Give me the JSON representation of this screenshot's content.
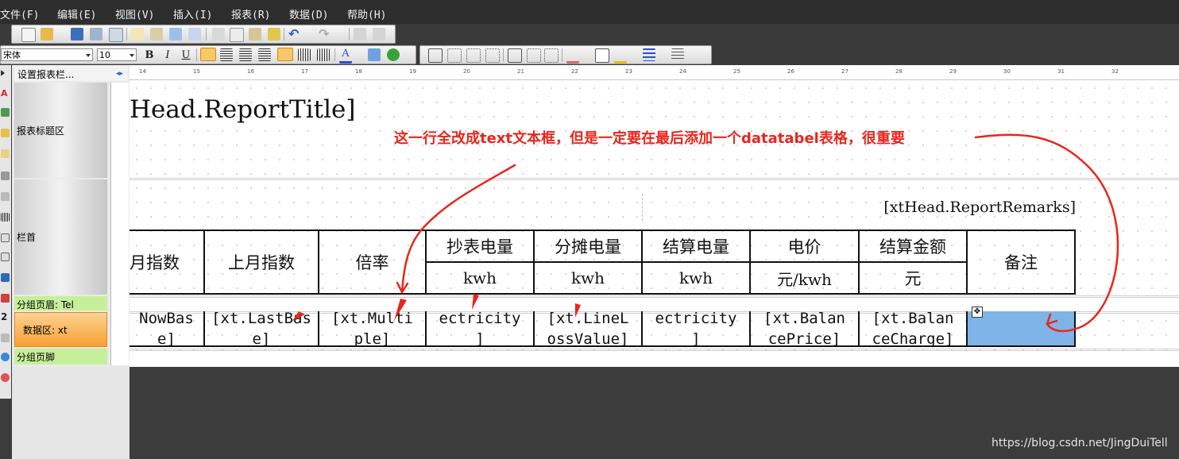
{
  "menu": [
    "文件(F)",
    "编辑(E)",
    "视图(V)",
    "插入(I)",
    "报表(R)",
    "数据(D)",
    "帮助(H)"
  ],
  "font_toolbar": {
    "font_name": "宋体",
    "font_size": "10",
    "bold": "B",
    "italic": "I",
    "underline": "U"
  },
  "band_panel": {
    "header": "设置报表栏...",
    "bands": [
      "报表标题区",
      "栏首",
      "分组页眉: Tel",
      "数据区: xt",
      "分组页脚"
    ]
  },
  "ruler": [
    "14",
    "15",
    "16",
    "17",
    "18",
    "19",
    "20",
    "21",
    "22",
    "23",
    "24",
    "25",
    "26",
    "27",
    "28",
    "29",
    "30",
    "31",
    "32"
  ],
  "report": {
    "title_field": "Head.ReportTitle]",
    "remarks_field": "[xtHead.ReportRemarks]",
    "header_cells": [
      "月指数",
      "上月指数",
      "倍率",
      "抄表电量",
      "分摊电量",
      "结算电量",
      "电价",
      "结算金额",
      "备注"
    ],
    "unit_cells": [
      "kwh",
      "kwh",
      "kwh",
      "元/kwh",
      "元"
    ],
    "data_cells": [
      "NowBas\ne]",
      "[xt.LastBas\ne]",
      "[xt.Multi\nple]",
      "ectricity\n]",
      "[xt.LineL\nossValue]",
      "ectricity\n]",
      "[xt.Balan\ncePrice]",
      "[xt.Balan\nceCharge]"
    ]
  },
  "annotation": "这一行全改成text文本框，但是一定要在最后添加一个datatabel表格，很重要",
  "watermark": "https://blog.csdn.net/JingDuiTell",
  "colors": {
    "annotation": "#e8261c",
    "selected_cell": "#7fb4e8",
    "group_band": "#c6ef9a",
    "data_band": "#f9a033"
  }
}
